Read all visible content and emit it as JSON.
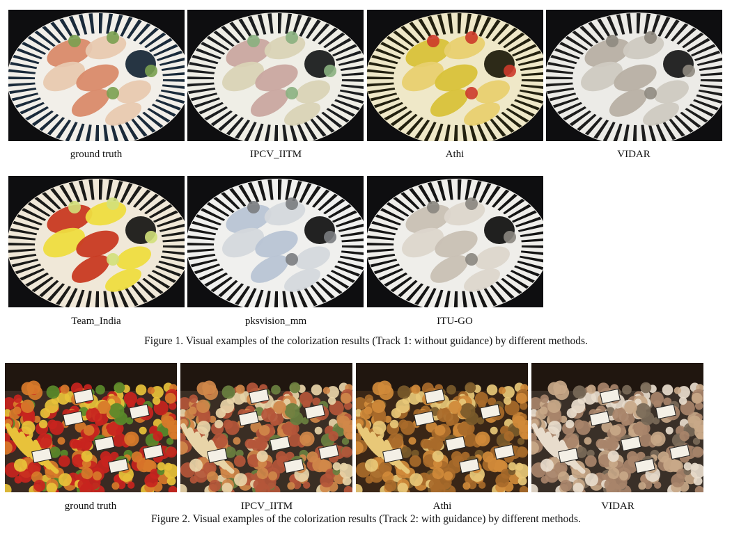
{
  "figure1": {
    "caption": "Figure 1. Visual examples of the colorization results (Track 1: without guidance) by different methods.",
    "panels": [
      {
        "label": "ground truth",
        "palette": [
          "#1a2a3a",
          "#f2efe9",
          "#d98a6a",
          "#e8c9b0",
          "#7aa050"
        ]
      },
      {
        "label": "IPCV_IITM",
        "palette": [
          "#1b1d1f",
          "#efeee6",
          "#c9a7a0",
          "#d9d3b6",
          "#8ab080"
        ]
      },
      {
        "label": "Athi",
        "palette": [
          "#22200f",
          "#efe8c8",
          "#d8c23a",
          "#e8d070",
          "#cc3a2a"
        ]
      },
      {
        "label": "VIDAR",
        "palette": [
          "#1c1c1c",
          "#ecebe7",
          "#b8b0a4",
          "#cfcac1",
          "#8f8a80"
        ]
      },
      {
        "label": "Team_India",
        "palette": [
          "#1a1a18",
          "#f0e8d8",
          "#c83a22",
          "#eedd40",
          "#d2e07a"
        ]
      },
      {
        "label": "pksvision_mm",
        "palette": [
          "#161616",
          "#f0f0ee",
          "#b8c4d4",
          "#d4d8dc",
          "#7a7c80"
        ]
      },
      {
        "label": "ITU-GO",
        "palette": [
          "#141414",
          "#efeeea",
          "#c8c0b4",
          "#dcd6cc",
          "#8a8680"
        ]
      }
    ]
  },
  "figure2": {
    "caption": "Figure 2. Visual examples of the colorization results (Track 2: with guidance) by different methods.",
    "panels": [
      {
        "label": "ground truth",
        "palette": [
          "#3a2a22",
          "#c8241e",
          "#e8c23a",
          "#5a8a2a",
          "#d87a2a"
        ]
      },
      {
        "label": "IPCV_IITM",
        "palette": [
          "#3a2e24",
          "#b4563a",
          "#e8d4a8",
          "#6a8040",
          "#d0884a"
        ]
      },
      {
        "label": "Athi",
        "palette": [
          "#3a2616",
          "#a86a2a",
          "#e8c878",
          "#7a5a2a",
          "#d08a3a"
        ]
      },
      {
        "label": "VIDAR",
        "palette": [
          "#3a3028",
          "#a8846a",
          "#e8dccc",
          "#7a6a58",
          "#c8a888"
        ]
      }
    ]
  }
}
